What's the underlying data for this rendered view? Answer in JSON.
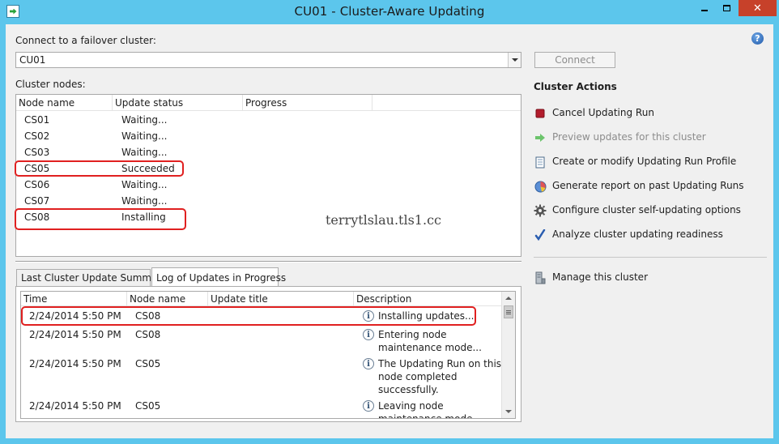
{
  "window": {
    "title": "CU01 - Cluster-Aware Updating"
  },
  "connect": {
    "label": "Connect to a failover cluster:",
    "cluster_value": "CU01",
    "connect_button": "Connect"
  },
  "nodes": {
    "label": "Cluster nodes:",
    "columns": [
      "Node name",
      "Update status",
      "Progress"
    ],
    "rows": [
      {
        "name": "CS01",
        "status": "Waiting..."
      },
      {
        "name": "CS02",
        "status": "Waiting..."
      },
      {
        "name": "CS03",
        "status": "Waiting..."
      },
      {
        "name": "CS05",
        "status": "Succeeded"
      },
      {
        "name": "CS06",
        "status": "Waiting..."
      },
      {
        "name": "CS07",
        "status": "Waiting..."
      },
      {
        "name": "CS08",
        "status": "Installing"
      }
    ]
  },
  "watermark": "terrytlslau.tls1.cc",
  "tabs": [
    "Last Cluster Update Summary",
    "Log of Updates in Progress"
  ],
  "log": {
    "columns": [
      "Time",
      "Node name",
      "Update title",
      "Description"
    ],
    "rows": [
      {
        "time": "2/24/2014 5:50 PM",
        "node": "CS08",
        "title": "",
        "desc": [
          "Installing updates..."
        ]
      },
      {
        "time": "2/24/2014 5:50 PM",
        "node": "CS08",
        "title": "",
        "desc": [
          "Entering node",
          "maintenance mode..."
        ]
      },
      {
        "time": "2/24/2014 5:50 PM",
        "node": "CS05",
        "title": "",
        "desc": [
          "The Updating Run on this",
          "node completed",
          "successfully."
        ]
      },
      {
        "time": "2/24/2014 5:50 PM",
        "node": "CS05",
        "title": "",
        "desc": [
          "Leaving node",
          "maintenance mode..."
        ]
      }
    ]
  },
  "cluster_actions": {
    "title": "Cluster Actions",
    "items": [
      {
        "label": "Cancel Updating Run",
        "icon": "stop-icon",
        "enabled": true
      },
      {
        "label": "Preview updates for this cluster",
        "icon": "arrow-right-icon",
        "enabled": false
      },
      {
        "label": "Create or modify Updating Run Profile",
        "icon": "profile-document-icon",
        "enabled": true
      },
      {
        "label": "Generate report on past Updating Runs",
        "icon": "report-chart-icon",
        "enabled": true
      },
      {
        "label": "Configure cluster self-updating options",
        "icon": "gear-icon",
        "enabled": true
      },
      {
        "label": "Analyze cluster updating readiness",
        "icon": "checkmark-icon",
        "enabled": true
      }
    ],
    "manage": {
      "label": "Manage this cluster",
      "icon": "server-icon"
    }
  },
  "colors": {
    "titlebar": "#5cc6ec",
    "close": "#c7412a",
    "highlight": "#e02020"
  }
}
